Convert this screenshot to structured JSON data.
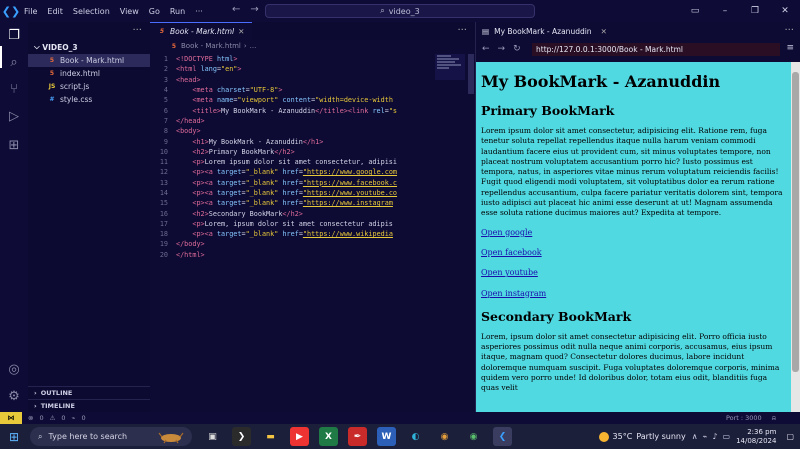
{
  "titlebar": {
    "menu": [
      "File",
      "Edit",
      "Selection",
      "View",
      "Go",
      "Run"
    ],
    "more": "···",
    "search_text": "video_3"
  },
  "sidebar": {
    "folder": "VIDEO_3",
    "files": [
      {
        "name": "Book - Mark.html",
        "type": "html",
        "selected": true
      },
      {
        "name": "index.html",
        "type": "html"
      },
      {
        "name": "script.js",
        "type": "js"
      },
      {
        "name": "style.css",
        "type": "css"
      }
    ],
    "outline_label": "OUTLINE",
    "timeline_label": "TIMELINE"
  },
  "editor": {
    "tab_label": "Book - Mark.html",
    "breadcrumb": "Book - Mark.html",
    "breadcrumb_more": "...",
    "line_numbers": [
      "1",
      "2",
      "3",
      "4",
      "5",
      "6",
      "7",
      "8",
      "9",
      "10",
      "11",
      "12",
      "13",
      "14",
      "15",
      "16",
      "17",
      "18",
      "19",
      "20"
    ]
  },
  "browser": {
    "tab_label": "My BookMark - Azanuddin",
    "url": "http://127.0.0.1:3000/Book - Mark.html",
    "page_h1": "My BookMark - Azanuddin",
    "page_h2_primary": "Primary BookMark",
    "page_p1": "Lorem ipsum dolor sit amet consectetur, adipisicing elit. Ratione rem, fuga tenetur soluta repellat repellendus itaque nulla harum veniam commodi laudantium facere eius ut provident cum, sit minus voluptates tempore, non placeat nostrum voluptatem accusantium porro hic? Iusto possimus est tempora, natus, in asperiores vitae minus rerum voluptatum reiciendis facilis! Fugit quod eligendi modi voluptatem, sit voluptatibus dolor ea rerum ratione repellendus accusantium, culpa facere pariatur veritatis dolorem sint, tempora iusto adipisci aut placeat hic animi esse deserunt at ut! Magnam assumenda esse soluta ratione ducimus maiores aut? Expedita at tempore.",
    "links": [
      "Open google",
      "Open facebook",
      "Open youtube",
      "Open instagram"
    ],
    "page_h2_secondary": "Secondary BookMark",
    "page_p2": "Lorem, ipsum dolor sit amet consectetur adipisicing elit. Porro officia iusto asperiores possimus odit nulla neque animi corporis, accusamus, eius ipsum itaque, magnam quod? Consectetur dolores ducimus, labore incidunt doloremque numquam suscipit. Fuga voluptates doloremque corporis, minima quidem vero porro unde! Id doloribus dolor, totam eius odit, blanditiis fuga quas velit"
  },
  "statusbar": {
    "errors": "0",
    "warnings": "0",
    "ports": "0",
    "port_label": "Port : 3000"
  },
  "taskbar": {
    "search_placeholder": "Type here to search",
    "temperature": "35°C",
    "weather": "Partly sunny",
    "time": "2:36 pm",
    "date": "14/08/2024"
  },
  "colors": {
    "page_background": "#51d9e2",
    "accent": "#4a6cff",
    "remote": "#e8c93a"
  }
}
